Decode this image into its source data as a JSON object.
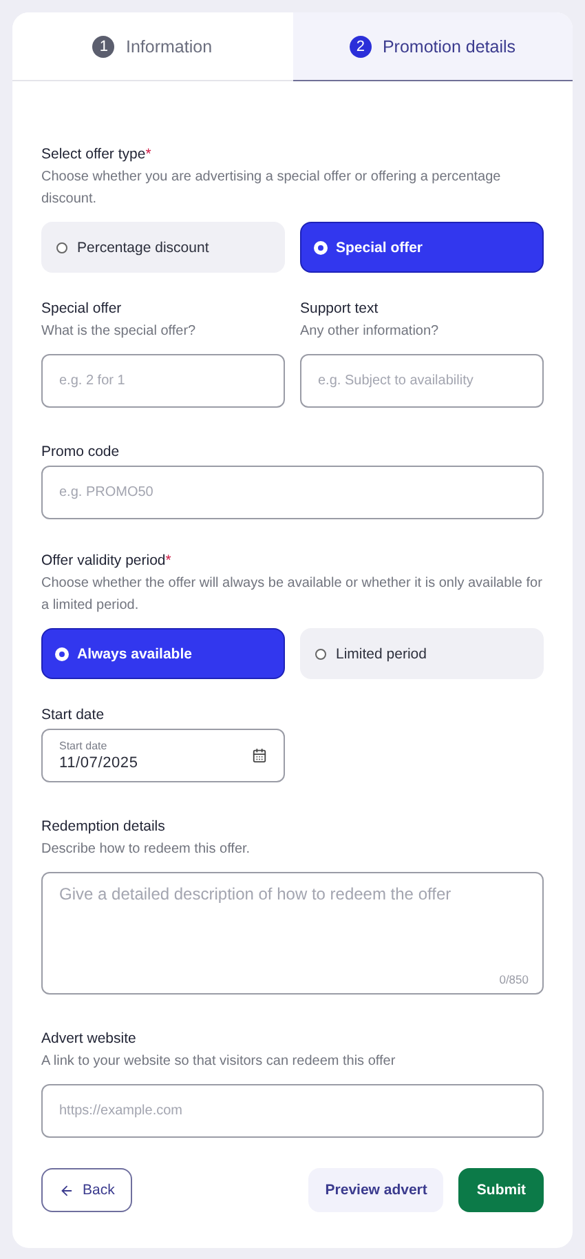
{
  "tabs": [
    {
      "number": "1",
      "label": "Information",
      "selected": false
    },
    {
      "number": "2",
      "label": "Promotion details",
      "selected": true
    }
  ],
  "sections": [
    {
      "kind": "radio_group",
      "label": "Select offer type",
      "required_mark": "*",
      "hint": "Choose whether you are advertising a special offer or offering a percentage discount.",
      "options": [
        {
          "label": "Percentage discount",
          "selected": false
        },
        {
          "label": "Special offer",
          "selected": true
        }
      ]
    },
    {
      "kind": "field_pair",
      "fields": [
        {
          "label": "Special offer",
          "hint": "What is the special offer?",
          "placeholder": "e.g. 2 for 1"
        },
        {
          "label": "Support text",
          "hint": "Any other information?",
          "placeholder": "e.g. Subject to availability"
        }
      ]
    },
    {
      "kind": "field",
      "label": "Promo code",
      "placeholder": "e.g. PROMO50"
    },
    {
      "kind": "radio_group",
      "label": "Offer validity period",
      "required_mark": "*",
      "hint": "Choose whether the offer will always be available or whether it is only available for a limited period.",
      "options": [
        {
          "label": "Always available",
          "selected": true
        },
        {
          "label": "Limited period",
          "selected": false
        }
      ]
    },
    {
      "kind": "date",
      "label": "Start date",
      "float_label": "Start date",
      "value": "11/07/2025"
    },
    {
      "kind": "textarea",
      "label": "Redemption details",
      "hint": "Describe how to redeem this offer.",
      "placeholder": "Give a detailed description of how to redeem the offer",
      "counter": "0/850"
    },
    {
      "kind": "field",
      "label": "Advert website",
      "hint": "A link to your website so that visitors can redeem this offer",
      "placeholder": "https://example.com"
    }
  ],
  "actions": {
    "back": "Back",
    "preview": "Preview advert",
    "submit": "Submit"
  }
}
